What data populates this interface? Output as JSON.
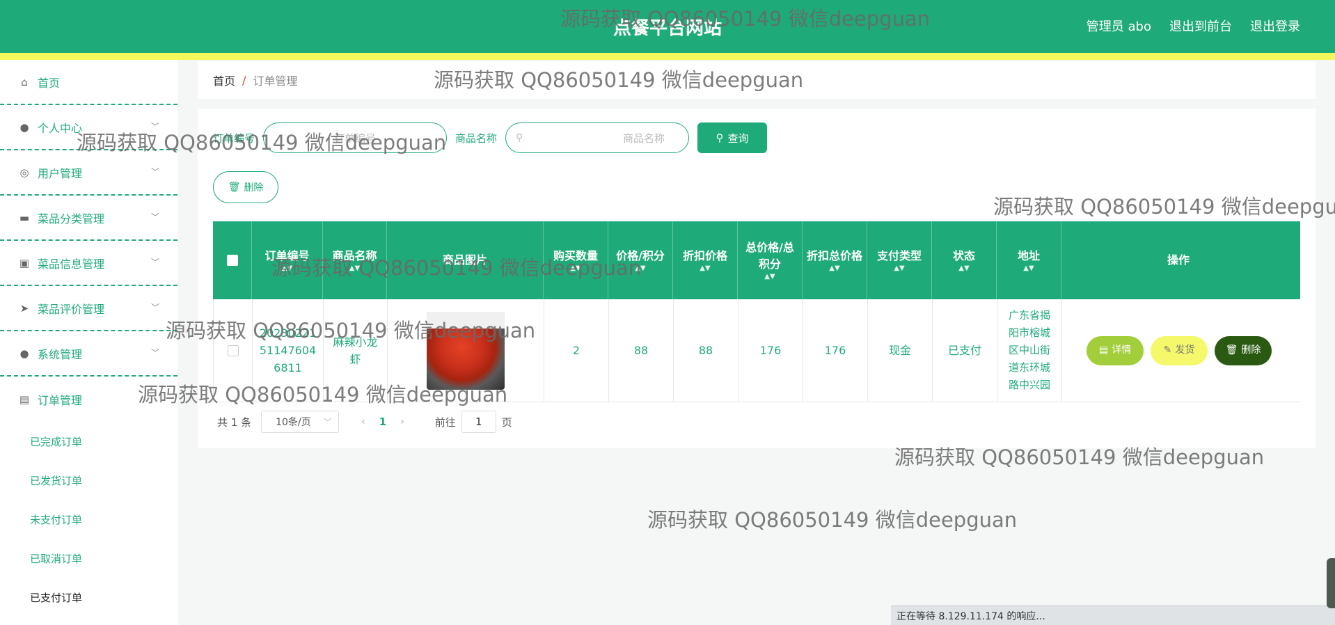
{
  "header": {
    "title": "点餐平台网站",
    "admin": "管理员 abo",
    "back_front": "退出到前台",
    "logout": "退出登录"
  },
  "sidebar": {
    "items": [
      {
        "label": "首页",
        "icon": "home-icon"
      },
      {
        "label": "个人中心",
        "icon": "user-icon"
      },
      {
        "label": "用户管理",
        "icon": "users-icon"
      },
      {
        "label": "菜品分类管理",
        "icon": "briefcase-icon"
      },
      {
        "label": "菜品信息管理",
        "icon": "clipboard-icon"
      },
      {
        "label": "菜品评价管理",
        "icon": "paper-plane-icon"
      },
      {
        "label": "系统管理",
        "icon": "user-icon"
      },
      {
        "label": "订单管理",
        "icon": "chat-icon"
      }
    ],
    "sub_items": [
      "已完成订单",
      "已发货订单",
      "未支付订单",
      "已取消订单",
      "已支付订单"
    ]
  },
  "breadcrumb": {
    "home": "首页",
    "sep": "/",
    "current": "订单管理"
  },
  "search": {
    "order_label": "订单编号",
    "order_placeholder": "订单编号",
    "name_label": "商品名称",
    "name_placeholder": "商品名称",
    "query_label": "查询"
  },
  "toolbar": {
    "delete_label": "删除"
  },
  "table": {
    "headers": [
      "订单编号",
      "商品名称",
      "商品图片",
      "购买数量",
      "价格/积分",
      "折扣价格",
      "总价格/总积分",
      "折扣总价格",
      "支付类型",
      "状态",
      "地址",
      "操作"
    ],
    "rows": [
      {
        "order_no": "2023022151147604 6811",
        "product_name": "麻辣小龙虾",
        "quantity": "2",
        "price": "88",
        "discount_price": "88",
        "total": "176",
        "discount_total": "176",
        "pay_type": "现金",
        "status": "已支付",
        "address": "广东省揭阳市榕城区中山街道东环城路中兴园",
        "actions": {
          "detail": "详情",
          "ship": "发货",
          "delete": "删除"
        }
      }
    ]
  },
  "pagination": {
    "total": "共 1 条",
    "page_size": "10条/页",
    "current": "1",
    "goto_prefix": "前往",
    "goto_value": "1",
    "goto_suffix": "页"
  },
  "watermark": "源码获取 QQ86050149 微信deepguan",
  "statusbar": {
    "text": "正在等待 8.129.11.174 的响应..."
  },
  "colors": {
    "primary": "#1faa79",
    "stripe": "#f2f75a",
    "detail": "#a3ce3c",
    "ship": "#f4f86a",
    "delete": "#2a5a12"
  }
}
